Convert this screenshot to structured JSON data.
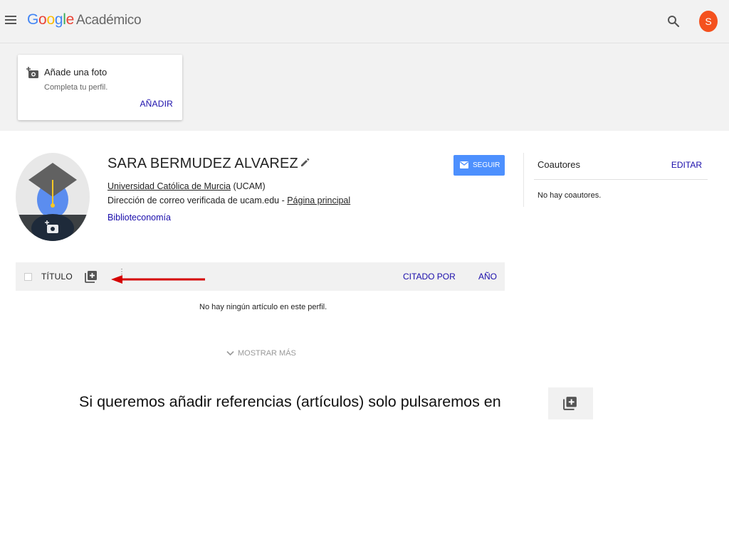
{
  "header": {
    "logo_letters": [
      "G",
      "o",
      "o",
      "g",
      "l",
      "e"
    ],
    "product": "Académico",
    "avatar_letter": "S",
    "icons": [
      "menu-icon",
      "search-icon",
      "account-avatar"
    ]
  },
  "photo_card": {
    "title": "Añade una foto",
    "subtitle": "Completa tu perfil.",
    "action": "AÑADIR",
    "icon": "add-photo-icon"
  },
  "profile": {
    "name": "SARA BERMUDEZ ALVAREZ",
    "affiliation_link": "Universidad Católica de Murcia",
    "affiliation_suffix": " (UCAM)",
    "email_text": "Dirección de correo verificada de ucam.edu - ",
    "homepage_link": "Página principal",
    "interest": "Biblioteconomía",
    "follow_label": "SEGUIR"
  },
  "coauthors": {
    "title": "Coautores",
    "edit": "EDITAR",
    "empty": "No hay coautores."
  },
  "articles": {
    "col_title": "TÍTULO",
    "dots": "⋮",
    "col_cited": "CITADO POR",
    "col_year": "AÑO",
    "empty": "No hay ningún artículo en este perfil.",
    "show_more": "MOSTRAR MÁS"
  },
  "caption": {
    "text": "Si queremos añadir referencias (artículos) solo pulsaremos en"
  },
  "colors": {
    "accent_blue": "#4d90fe",
    "link": "#1a0dab",
    "annotation_arrow": "#d50000",
    "avatar": "#f4511e"
  }
}
